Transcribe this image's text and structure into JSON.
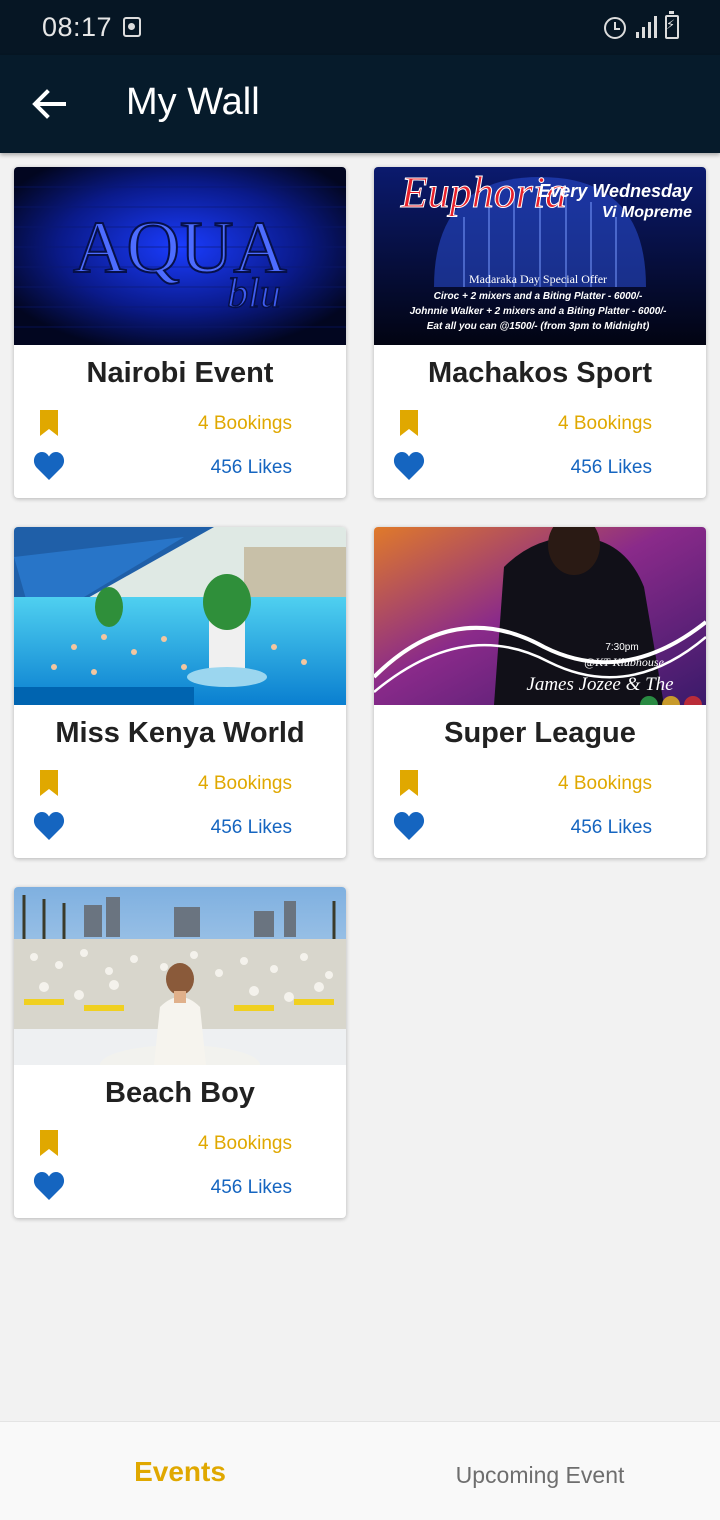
{
  "status_bar": {
    "time": "08:17"
  },
  "app_bar": {
    "title": "My Wall",
    "back_icon": "arrow-left-icon"
  },
  "colors": {
    "bookings": "#e0a800",
    "likes": "#1565c0",
    "app_bar": "#061b2b",
    "active_tab": "#e0a800"
  },
  "events": [
    {
      "title": "Nairobi Event",
      "bookings": "4 Bookings",
      "likes": "456 Likes",
      "image_text": {
        "main": "AQUA",
        "sub": "blu"
      }
    },
    {
      "title": "Machakos Sport",
      "bookings": "4 Bookings",
      "likes": "456 Likes",
      "image_text": {
        "headline": "Euphoria",
        "line1": "Every Wednesday",
        "line2": "Vi Mopreme",
        "offer": "Madaraka Day Special Offer",
        "d1": "Ciroc + 2 mixers and a Biting Platter - 6000/-",
        "d2": "Johnnie Walker + 2 mixers and a Biting Platter - 6000/-",
        "d3": "Eat all you can @1500/- (from 3pm to Midnight)"
      }
    },
    {
      "title": "Miss Kenya World",
      "bookings": "4 Bookings",
      "likes": "456 Likes"
    },
    {
      "title": "Super League",
      "bookings": "4 Bookings",
      "likes": "456 Likes",
      "image_text": {
        "time": "7:30pm",
        "venue": "@KT Klubhouse",
        "artist": "James Jozee & The"
      }
    },
    {
      "title": "Beach Boy",
      "bookings": "4 Bookings",
      "likes": "456 Likes"
    }
  ],
  "bottom_nav": {
    "tabs": [
      {
        "label": "Events",
        "active": true
      },
      {
        "label": "Upcoming Event",
        "active": false
      }
    ]
  }
}
